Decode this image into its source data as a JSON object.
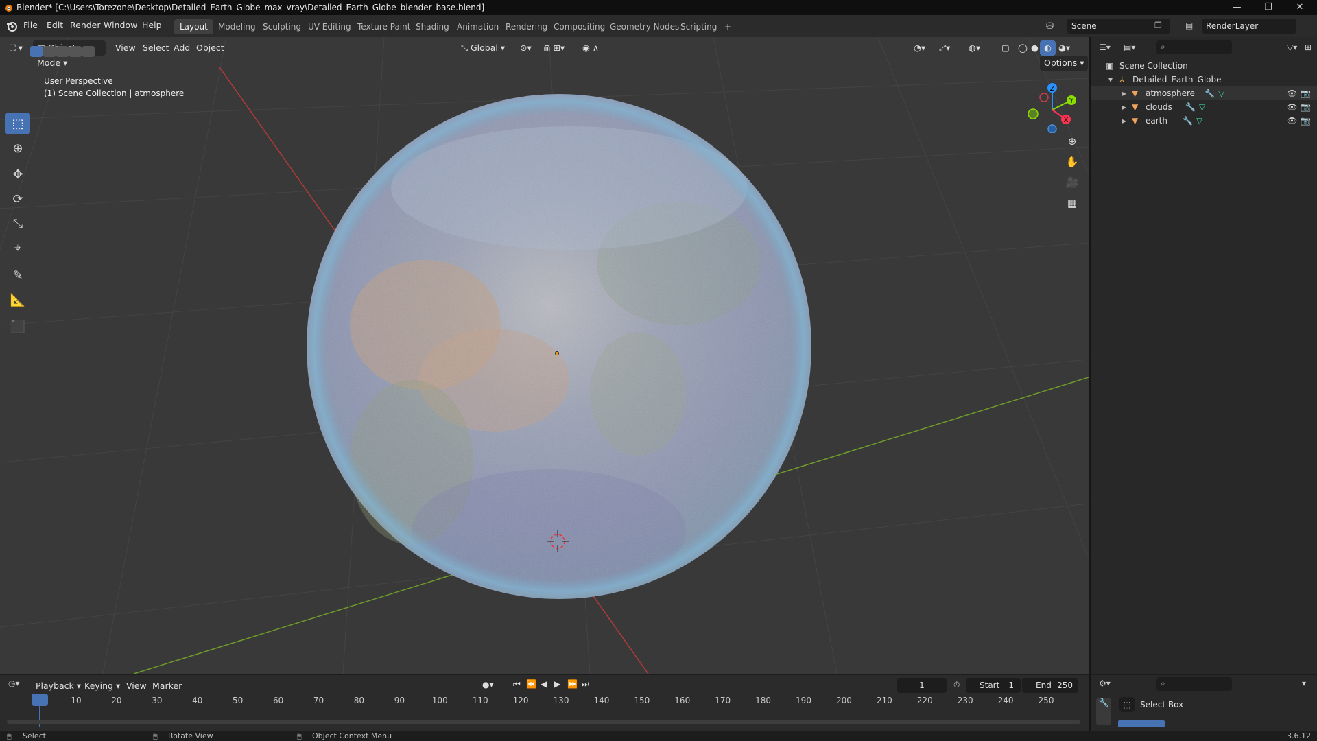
{
  "title_bar": {
    "title": "Blender* [C:\\Users\\Torezone\\Desktop\\Detailed_Earth_Globe_max_vray\\Detailed_Earth_Globe_blender_base.blend]",
    "minimize": "—",
    "maximize": "❐",
    "close": "✕"
  },
  "menu": {
    "items": [
      "File",
      "Edit",
      "Render",
      "Window",
      "Help"
    ],
    "workspaces": [
      "Layout",
      "Modeling",
      "Sculpting",
      "UV Editing",
      "Texture Paint",
      "Shading",
      "Animation",
      "Rendering",
      "Compositing",
      "Geometry Nodes",
      "Scripting"
    ],
    "active_workspace": "Layout",
    "add_workspace": "+",
    "scene": "Scene",
    "view_layer": "RenderLayer"
  },
  "viewport_header": {
    "mode": "Object Mode",
    "menus": [
      "View",
      "Select",
      "Add",
      "Object"
    ],
    "orientation": "Global",
    "options": "Options"
  },
  "viewport": {
    "perspective": "User Perspective",
    "collection_info": "(1) Scene Collection | atmosphere",
    "axes": {
      "x": "X",
      "y": "Y",
      "z": "Z"
    }
  },
  "tools": [
    "select-box",
    "cursor",
    "move",
    "rotate",
    "scale",
    "transform",
    "annotate",
    "measure",
    "add-cube"
  ],
  "outliner": {
    "root": "Scene Collection",
    "collection": "Detailed_Earth_Globe",
    "objects": [
      "atmosphere",
      "clouds",
      "earth"
    ]
  },
  "timeline": {
    "menus": [
      "Playback",
      "Keying",
      "View",
      "Marker"
    ],
    "current_frame": "1",
    "start_label": "Start",
    "start_value": "1",
    "end_label": "End",
    "end_value": "250",
    "ticks": [
      "1",
      "10",
      "20",
      "30",
      "40",
      "50",
      "60",
      "70",
      "80",
      "90",
      "100",
      "110",
      "120",
      "130",
      "140",
      "150",
      "160",
      "170",
      "180",
      "190",
      "200",
      "210",
      "220",
      "230",
      "240",
      "250"
    ]
  },
  "properties": {
    "active_tool": "Select Box"
  },
  "status_bar": {
    "select": "Select",
    "rotate_view": "Rotate View",
    "context_menu": "Object Context Menu",
    "version": "3.6.12"
  },
  "colors": {
    "accent": "#4772b3",
    "axis_x": "#ff3352",
    "axis_y": "#8bdc00",
    "axis_z": "#2890ff"
  }
}
